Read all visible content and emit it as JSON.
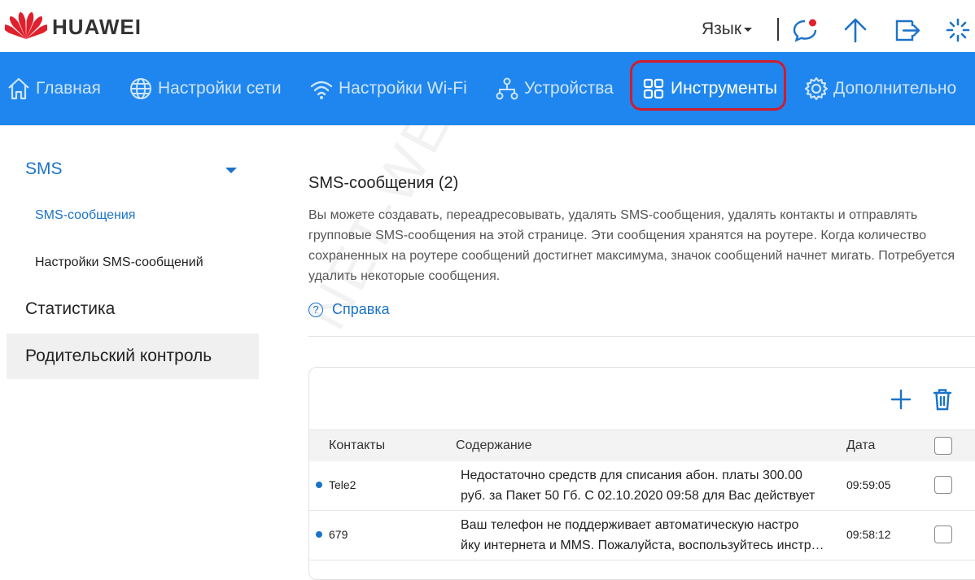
{
  "header": {
    "brand": "HUAWEI",
    "language_label": "Язык",
    "icons": [
      "messages-icon",
      "update-icon",
      "logout-icon",
      "loading-icon"
    ]
  },
  "nav": {
    "items": [
      {
        "label": "Главная",
        "icon": "home-icon"
      },
      {
        "label": "Настройки сети",
        "icon": "globe-icon"
      },
      {
        "label": "Настройки Wi-Fi",
        "icon": "wifi-icon"
      },
      {
        "label": "Устройства",
        "icon": "devices-icon"
      },
      {
        "label": "Инструменты",
        "icon": "tools-icon",
        "active": true
      },
      {
        "label": "Дополнительно",
        "icon": "gear-icon"
      }
    ],
    "active_color": "#ffffff",
    "bar_color": "#1e86ee",
    "highlight_color": "#d21c2c"
  },
  "sidebar": {
    "sms": "SMS",
    "sms_messages": "SMS-сообщения",
    "sms_settings": "Настройки SMS-сообщений",
    "statistics": "Статистика",
    "parental_control": "Родительский контроль"
  },
  "main": {
    "title": "SMS-сообщения (2)",
    "description": "Вы можете создавать, переадресовывать, удалять SMS-сообщения, удалять контакты и отправлять групповые SMS-сообщения на этой странице. Эти сообщения хранятся на роутере. Когда количество сохраненных на роутере сообщений достигнет максимума, значок сообщений начнет мигать. Потребуется удалить некоторые сообщения.",
    "help": "Справка",
    "table": {
      "headers": {
        "contacts": "Контакты",
        "content": "Содержание",
        "date": "Дата"
      },
      "rows": [
        {
          "contact": "Tele2",
          "line1": "Недостаточно средств для списания абон. платы 300.00",
          "line2": "руб. за Пакет 50 Гб. С 02.10.2020 09:58 для Вас действует",
          "time": "09:59:05"
        },
        {
          "contact": "679",
          "line1": "Ваш телефон не поддерживает автоматическую настро",
          "line2": "йку интернета и MMS. Пожалуйста, воспользуйтесь инструкцией",
          "time": "09:58:12"
        }
      ]
    }
  },
  "watermark": "NET-WELL.RU"
}
